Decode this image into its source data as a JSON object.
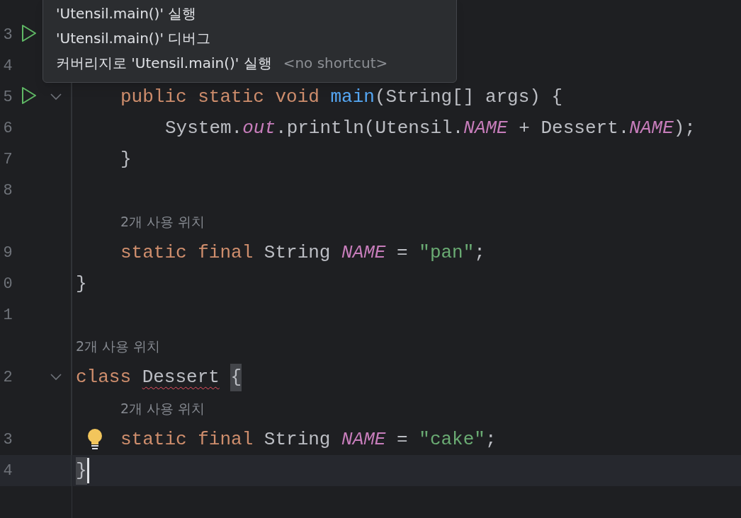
{
  "tooltip": {
    "items": [
      {
        "label": "'Utensil.main()' 실행"
      },
      {
        "label": "'Utensil.main()' 디버그"
      },
      {
        "label": "커버리지로 'Utensil.main()' 실행",
        "shortcut": "<no shortcut>"
      }
    ]
  },
  "lines": [
    {
      "run": false,
      "current": false
    },
    {
      "number": "3",
      "run": true,
      "fold": false,
      "current": false,
      "children": [
        {
          "number": "4",
          "run": false,
          "current": false
        },
        {
          "number": "5",
          "run": true,
          "fold": true,
          "current": false,
          "tokens": [
            {
              "kind": "keyword",
              "text": "public static void "
            },
            {
              "kind": "method",
              "text": "main"
            },
            {
              "kind": "plain",
              "text": "(String[] args) {"
            }
          ],
          "children": [
            {
              "number": "6",
              "run": false,
              "fold": false,
              "current": false,
              "tokens": [
                {
                  "kind": "plain",
                  "text": "System."
                },
                {
                  "kind": "field",
                  "text": "out"
                },
                {
                  "kind": "plain",
                  "text": ".println(Utensil."
                },
                {
                  "kind": "field",
                  "text": "NAME"
                },
                {
                  "kind": "plain",
                  "text": " + Dessert."
                },
                {
                  "kind": "field",
                  "text": "NAME"
                },
                {
                  "kind": "plain",
                  "text": ");"
                }
              ]
            }
          ]
        },
        {
          "number": "7",
          "run": false,
          "fold": false,
          "current": false,
          "tokens": [
            {
              "kind": "plain",
              "text": "}"
            }
          ]
        },
        {
          "number": "8",
          "run": false,
          "fold": false,
          "current": false
        },
        {
          "number": "9",
          "run": false,
          "fold": false,
          "current": false,
          "hint": "2개 사용 위치",
          "tokens": [
            {
              "kind": "keyword",
              "text": "static final "
            },
            {
              "kind": "plain",
              "text": "String "
            },
            {
              "kind": "field",
              "text": "NAME"
            },
            {
              "kind": "plain",
              "text": " = "
            },
            {
              "kind": "string",
              "text": "\"pan\""
            },
            {
              "kind": "plain",
              "text": ";"
            }
          ]
        }
      ]
    },
    {
      "number": "0",
      "run": false,
      "fold": false,
      "current": false,
      "tokens": [
        {
          "kind": "plain",
          "text": "}"
        }
      ]
    },
    {
      "number": "1",
      "run": false,
      "fold": false,
      "current": false
    },
    {
      "number": "2",
      "run": false,
      "fold": true,
      "current": false,
      "hint": "2개 사용 위치",
      "tokens": [
        {
          "kind": "keyword",
          "text": "class "
        },
        {
          "kind": "plain",
          "text": "Dessert",
          "error": true
        },
        {
          "kind": "plain",
          "text": "{",
          "matched": true,
          "space_before": true
        }
      ],
      "children": [
        {
          "number": "3",
          "run": false,
          "fold": false,
          "current": false,
          "bulb": true,
          "hint": "2개 사용 위치",
          "tokens": [
            {
              "kind": "keyword",
              "text": "static final "
            },
            {
              "kind": "plain",
              "text": "String "
            },
            {
              "kind": "field",
              "text": "NAME"
            },
            {
              "kind": "plain",
              "text": " = "
            },
            {
              "kind": "string",
              "text": "\"cake\""
            },
            {
              "kind": "plain",
              "text": ";"
            }
          ]
        }
      ]
    },
    {
      "number": "4",
      "run": false,
      "fold": false,
      "current": true,
      "tokens": [
        {
          "kind": "plain",
          "text": "}",
          "matched": true
        }
      ]
    }
  ]
}
